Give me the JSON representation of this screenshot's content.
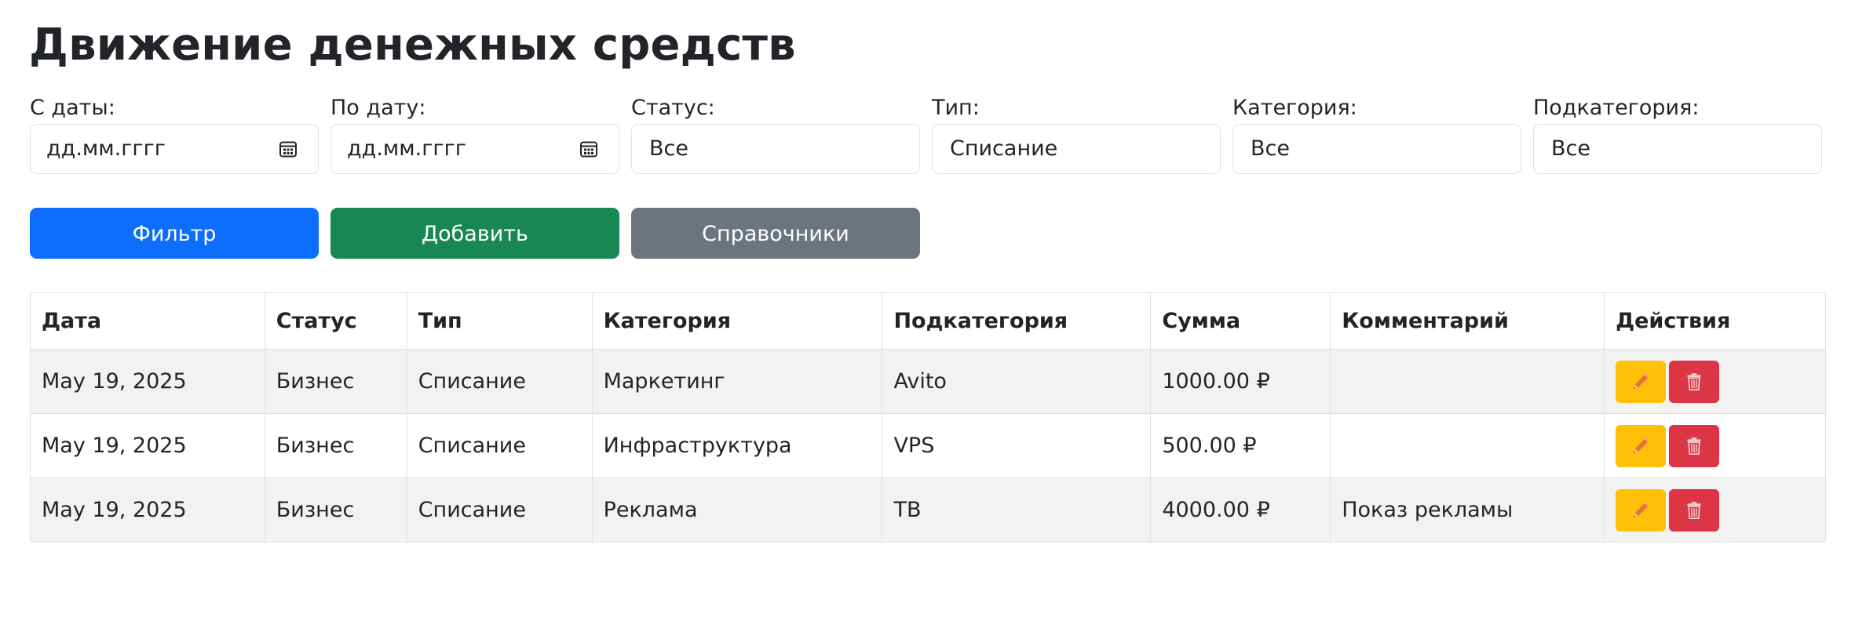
{
  "page": {
    "title": "Движение денежных средств"
  },
  "filters": {
    "date_from": {
      "label": "С даты:",
      "value": "дд.мм.гггг"
    },
    "date_to": {
      "label": "По дату:",
      "value": "дд.мм.гггг"
    },
    "status": {
      "label": "Статус:",
      "value": "Все"
    },
    "type": {
      "label": "Тип:",
      "value": "Списание"
    },
    "category": {
      "label": "Категория:",
      "value": "Все"
    },
    "subcategory": {
      "label": "Подкатегория:",
      "value": "Все"
    }
  },
  "buttons": {
    "filter": "Фильтр",
    "add": "Добавить",
    "references": "Справочники"
  },
  "colors": {
    "primary": "#0d6efd",
    "success": "#198754",
    "secondary": "#6c757d",
    "edit": "#ffc107",
    "delete": "#dc3545"
  },
  "icons": {
    "edit": "pencil-icon",
    "delete": "trash-icon",
    "date": "calendar-icon"
  },
  "table": {
    "headers": [
      "Дата",
      "Статус",
      "Тип",
      "Категория",
      "Подкатегория",
      "Сумма",
      "Комментарий",
      "Действия"
    ],
    "rows": [
      {
        "date": "May 19, 2025",
        "status": "Бизнес",
        "type": "Списание",
        "category": "Маркетинг",
        "subcategory": "Avito",
        "amount": "1000.00 ₽",
        "comment": ""
      },
      {
        "date": "May 19, 2025",
        "status": "Бизнес",
        "type": "Списание",
        "category": "Инфраструктура",
        "subcategory": "VPS",
        "amount": "500.00 ₽",
        "comment": ""
      },
      {
        "date": "May 19, 2025",
        "status": "Бизнес",
        "type": "Списание",
        "category": "Реклама",
        "subcategory": "ТВ",
        "amount": "4000.00 ₽",
        "comment": "Показ рекламы"
      }
    ]
  }
}
